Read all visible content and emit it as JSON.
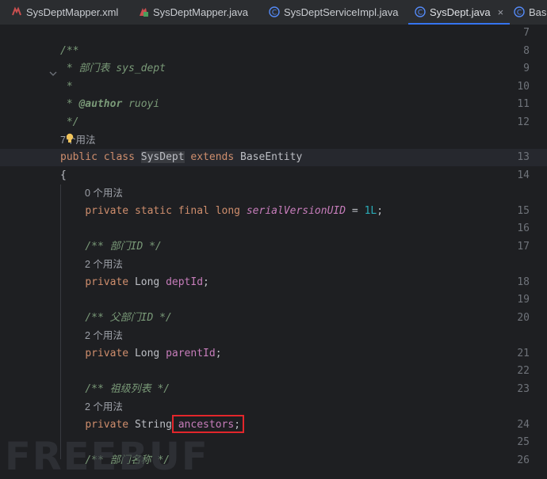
{
  "tabs": [
    {
      "label": "SysDeptMapper.xml",
      "icon": "mybatis-xml-icon",
      "active": false
    },
    {
      "label": "SysDeptMapper.java",
      "icon": "interface-icon",
      "active": false
    },
    {
      "label": "SysDeptServiceImpl.java",
      "icon": "class-icon",
      "active": false
    },
    {
      "label": "SysDept.java",
      "icon": "class-icon",
      "active": true
    },
    {
      "label": "Base",
      "icon": "class-icon",
      "active": false
    }
  ],
  "tab_close": "×",
  "lines": {
    "n7": "7",
    "n8": "8",
    "n9": "9",
    "n10": "10",
    "n11": "11",
    "n12": "12",
    "n13": "13",
    "n14": "14",
    "n15": "15",
    "n16": "16",
    "n17": "17",
    "n18": "18",
    "n19": "19",
    "n20": "20",
    "n21": "21",
    "n22": "22",
    "n23": "23",
    "n24": "24",
    "n25": "25",
    "n26": "26"
  },
  "code": {
    "javadoc_open": "/**",
    "javadoc_star": "*",
    "desc": "部门表 sys_dept",
    "author_tag": "@author",
    "author_name": "ruoyi",
    "javadoc_close": "*/",
    "usages_class": "7个用法",
    "kw_public": "public",
    "kw_class": "class",
    "class_name": "SysDept",
    "kw_extends": "extends",
    "super_name": "BaseEntity",
    "brace_open": "{",
    "usages_0": "0 个用法",
    "kw_private": "private",
    "kw_static": "static",
    "kw_final": "final",
    "kw_long": "long",
    "serial_name": "serialVersionUID",
    "assign": " = ",
    "serial_value": "1L",
    "semicolon": ";",
    "comment_deptid": "/** 部门ID */",
    "usages_2a": "2 个用法",
    "type_long": "Long",
    "field_deptid": "deptId",
    "comment_parentid": "/** 父部门ID */",
    "usages_2b": "2 个用法",
    "field_parentid": "parentId",
    "comment_ancestors": "/** 祖级列表 */",
    "usages_2c": "2 个用法",
    "type_string": "String",
    "field_ancestors": "ancestors",
    "comment_deptname": "/** 部门名称 */"
  },
  "watermark": "FREEBUF",
  "colors": {
    "background": "#1e1f22",
    "keyword": "#cf8e6d",
    "field": "#c77dbb",
    "number": "#2aacb8",
    "comment": "#7a9a78",
    "highlight_box": "#e3262b",
    "active_tab_underline": "#3574f0"
  }
}
